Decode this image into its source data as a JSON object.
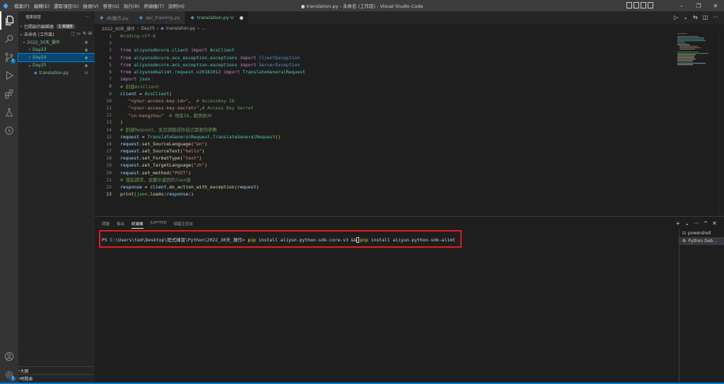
{
  "titlebar": {
    "menus": [
      "檔案(F)",
      "編輯(E)",
      "選取項目(S)",
      "檢視(V)",
      "移至(G)",
      "執行(R)",
      "終端機(T)",
      "說明(H)"
    ],
    "title": "● translation.py - 未命名 (工作區) - Visual Studio Code"
  },
  "activity": {
    "scm_badge": "1",
    "settings_badge": "1"
  },
  "sidebar": {
    "header": "檔案總管",
    "open_editors": "已開啟的編輯器",
    "unsaved_pill": "1 未儲存",
    "workspace": "未命名 (工作區)",
    "tree": [
      {
        "label": "2022_30天_操作",
        "indent": 0
      },
      {
        "label": "Day23",
        "indent": 1
      },
      {
        "label": "Day24",
        "indent": 1
      },
      {
        "label": "Day25",
        "indent": 1
      },
      {
        "label": "translation.py",
        "indent": 2,
        "status": "U"
      }
    ],
    "outline": "大綱",
    "timeline": "時間表"
  },
  "tabs": [
    {
      "label": "db操作.py"
    },
    {
      "label": "api_training.py"
    },
    {
      "label": "translation.py U"
    }
  ],
  "breadcrumb": [
    "2022_30天_操作",
    "Day25",
    "translation.py",
    "..."
  ],
  "code_lines": [
    {
      "n": "1",
      "parts": [
        [
          "#coding:utf-8",
          "#6a9955"
        ]
      ]
    },
    {
      "n": "2",
      "parts": []
    },
    {
      "n": "3",
      "parts": [
        [
          "from ",
          "#c586c0"
        ],
        [
          "aliyunsdkcore.client ",
          "#4ec9b0"
        ],
        [
          "import ",
          "#c586c0"
        ],
        [
          "AcsClient",
          "#4ec9b0"
        ]
      ]
    },
    {
      "n": "4",
      "parts": [
        [
          "from ",
          "#c586c0"
        ],
        [
          "aliyunsdkcore.acs_exception.exceptions ",
          "#4ec9b0"
        ],
        [
          "import ",
          "#c586c0"
        ],
        [
          "ClientException",
          "#4e94ce"
        ]
      ]
    },
    {
      "n": "5",
      "parts": [
        [
          "from ",
          "#c586c0"
        ],
        [
          "aliyunsdkcore.acs_exception.exceptions ",
          "#4ec9b0"
        ],
        [
          "import ",
          "#c586c0"
        ],
        [
          "ServerException",
          "#4e94ce"
        ]
      ]
    },
    {
      "n": "6",
      "parts": [
        [
          "from ",
          "#c586c0"
        ],
        [
          "aliyunsdkalimt.request.v20181012 ",
          "#4ec9b0"
        ],
        [
          "import ",
          "#c586c0"
        ],
        [
          "TranslateGeneralRequest",
          "#4ec9b0"
        ]
      ]
    },
    {
      "n": "7",
      "parts": [
        [
          "import ",
          "#c586c0"
        ],
        [
          "json",
          "#4ec9b0"
        ]
      ]
    },
    {
      "n": "8",
      "parts": [
        [
          "# 創建AcsClient",
          "#6a9955"
        ]
      ]
    },
    {
      "n": "9",
      "parts": [
        [
          "client",
          "#9cdcfe"
        ],
        [
          " = ",
          "#d4d4d4"
        ],
        [
          "AcsClient",
          "#4ec9b0"
        ],
        [
          "(",
          "#ffd700"
        ]
      ]
    },
    {
      "n": "10",
      "parts": [
        [
          "   ",
          "#d4d4d4"
        ],
        [
          "\"<your-access-key-id>\"",
          "#ce9178"
        ],
        [
          ",  ",
          "#d4d4d4"
        ],
        [
          "# AccessKey ID",
          "#6a9955"
        ]
      ]
    },
    {
      "n": "11",
      "parts": [
        [
          "   ",
          "#d4d4d4"
        ],
        [
          "\"<your-access-key-secret>\"",
          "#ce9178"
        ],
        [
          ",",
          "#d4d4d4"
        ],
        [
          "# Access Key Secret",
          "#6a9955"
        ]
      ]
    },
    {
      "n": "12",
      "parts": [
        [
          "   ",
          "#d4d4d4"
        ],
        [
          "\"cn-hangzhou\"",
          "#ce9178"
        ],
        [
          "  ",
          "#d4d4d4"
        ],
        [
          "# 地區ID，範例杭州",
          "#6a9955"
        ]
      ]
    },
    {
      "n": "13",
      "parts": [
        [
          ")",
          "#ffd700"
        ]
      ]
    },
    {
      "n": "14",
      "parts": [
        [
          "# 創建Request，並且調整成你自己需要的參數",
          "#6a9955"
        ]
      ]
    },
    {
      "n": "15",
      "parts": [
        [
          "request",
          "#9cdcfe"
        ],
        [
          " = ",
          "#d4d4d4"
        ],
        [
          "TranslateGeneralRequest",
          "#4ec9b0"
        ],
        [
          ".",
          "#d4d4d4"
        ],
        [
          "TranslateGeneralRequest",
          "#4ec9b0"
        ],
        [
          "()",
          "#ffd700"
        ]
      ]
    },
    {
      "n": "16",
      "parts": [
        [
          "request",
          "#9cdcfe"
        ],
        [
          ".",
          "#d4d4d4"
        ],
        [
          "set_SourceLanguage",
          "#dcdcaa"
        ],
        [
          "(",
          "#ffd700"
        ],
        [
          "\"en\"",
          "#ce9178"
        ],
        [
          ")",
          "#ffd700"
        ]
      ]
    },
    {
      "n": "17",
      "parts": [
        [
          "request",
          "#9cdcfe"
        ],
        [
          ".",
          "#d4d4d4"
        ],
        [
          "set_SourceText",
          "#dcdcaa"
        ],
        [
          "(",
          "#ffd700"
        ],
        [
          "\"hello\"",
          "#ce9178"
        ],
        [
          ")",
          "#ffd700"
        ]
      ]
    },
    {
      "n": "18",
      "parts": [
        [
          "request",
          "#9cdcfe"
        ],
        [
          ".",
          "#d4d4d4"
        ],
        [
          "set_FormatType",
          "#dcdcaa"
        ],
        [
          "(",
          "#ffd700"
        ],
        [
          "\"text\"",
          "#ce9178"
        ],
        [
          ")",
          "#ffd700"
        ]
      ]
    },
    {
      "n": "19",
      "parts": [
        [
          "request",
          "#9cdcfe"
        ],
        [
          ".",
          "#d4d4d4"
        ],
        [
          "set_TargetLanguage",
          "#dcdcaa"
        ],
        [
          "(",
          "#ffd700"
        ],
        [
          "\"zh\"",
          "#ce9178"
        ],
        [
          ")",
          "#ffd700"
        ]
      ]
    },
    {
      "n": "20",
      "parts": [
        [
          "request",
          "#9cdcfe"
        ],
        [
          ".",
          "#d4d4d4"
        ],
        [
          "set_method",
          "#dcdcaa"
        ],
        [
          "(",
          "#ffd700"
        ],
        [
          "\"POST\"",
          "#ce9178"
        ],
        [
          ")",
          "#ffd700"
        ]
      ]
    },
    {
      "n": "21",
      "parts": [
        [
          "# 發起請求，並顯示返回的Json值",
          "#6a9955"
        ]
      ]
    },
    {
      "n": "22",
      "parts": [
        [
          "response",
          "#9cdcfe"
        ],
        [
          " = ",
          "#d4d4d4"
        ],
        [
          "client",
          "#9cdcfe"
        ],
        [
          ".",
          "#d4d4d4"
        ],
        [
          "do_action_with_exception",
          "#dcdcaa"
        ],
        [
          "(",
          "#ffd700"
        ],
        [
          "request",
          "#9cdcfe"
        ],
        [
          ")",
          "#ffd700"
        ]
      ]
    },
    {
      "n": "23",
      "parts": [
        [
          "print",
          "#dcdcaa"
        ],
        [
          "(",
          "#ffd700"
        ],
        [
          "json",
          "#4ec9b0"
        ],
        [
          ".",
          "#d4d4d4"
        ],
        [
          "loads",
          "#dcdcaa"
        ],
        [
          "(",
          "#da70d6"
        ],
        [
          "response",
          "#9cdcfe"
        ],
        [
          ")",
          "#da70d6"
        ],
        [
          ")",
          "#ffd700"
        ]
      ]
    }
  ],
  "panel": {
    "tabs": [
      "問題",
      "輸出",
      "終端機",
      "JUPYTER",
      "偵錯主控台"
    ],
    "active_tab": "終端機",
    "prompt": "PS C:\\Users\\ted\\Desktop\\程式練習\\Python\\2022_30天_操作>",
    "cmd1_head": "pip",
    "cmd1_tail": " install aliyun-python-sdk-core-v3 &&",
    "cmd2_head": "pip",
    "cmd2_tail": " install aliyun-python-sdk-alimt",
    "terminals": [
      "powershell",
      "Python Deb..."
    ]
  }
}
